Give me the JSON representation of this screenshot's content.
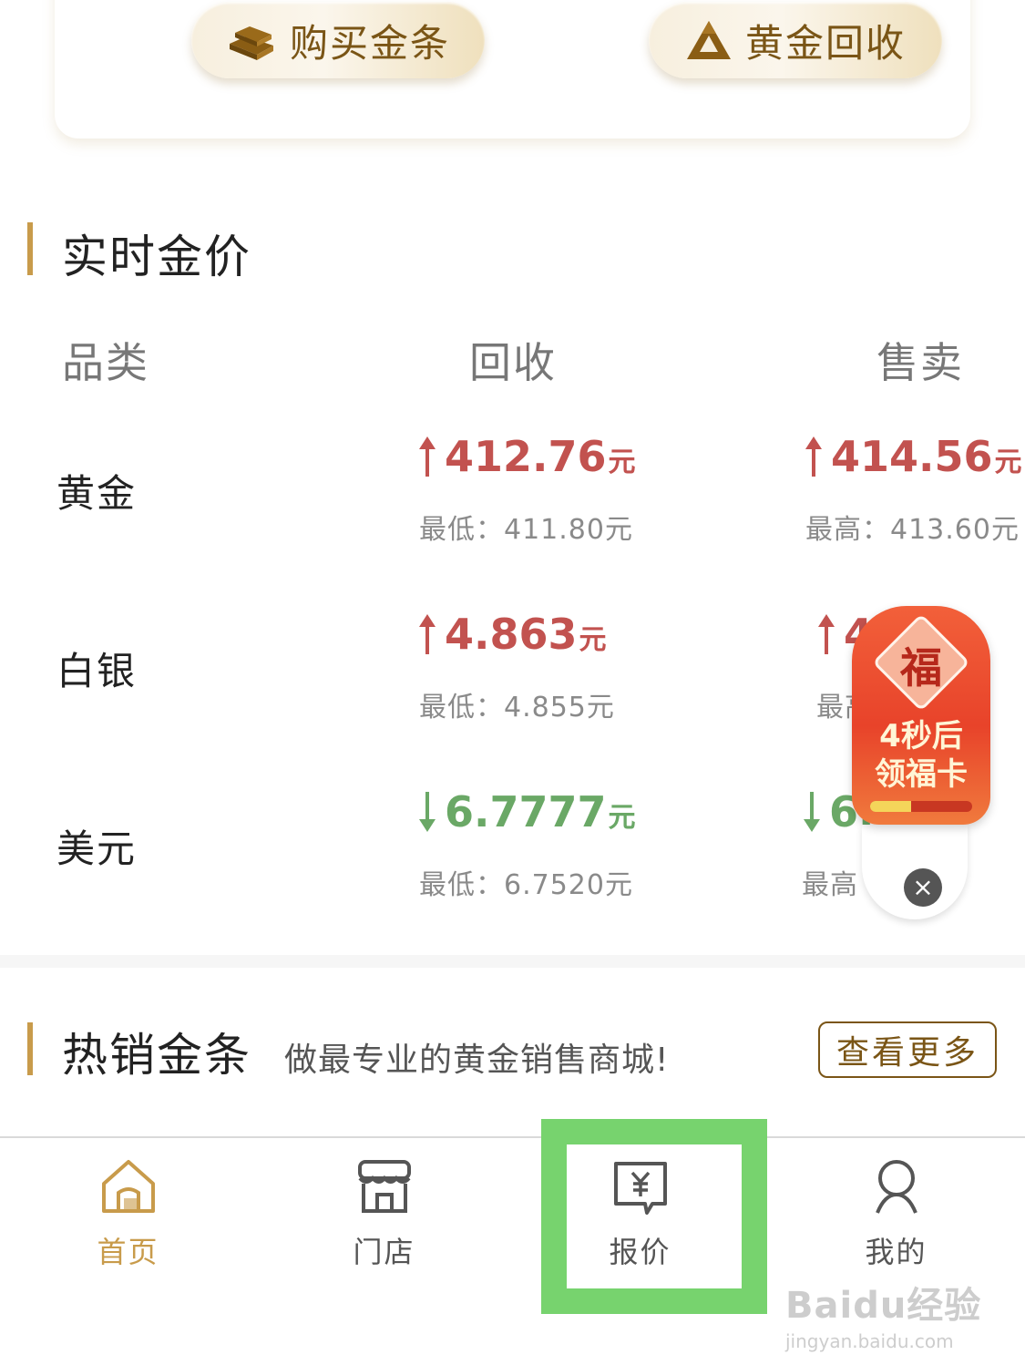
{
  "actions": {
    "buy_label": "购买金条",
    "recycle_label": "黄金回收"
  },
  "realtime": {
    "title": "实时金价",
    "headers": [
      "品类",
      "回收",
      "售卖"
    ],
    "rows": [
      {
        "name": "黄金",
        "recycle": "412.76",
        "recycle_dir": "up",
        "recycle_sub": "最低：411.80元",
        "sell": "414.56",
        "sell_dir": "up",
        "sell_sub": "最高：413.60元"
      },
      {
        "name": "白银",
        "recycle": "4.863",
        "recycle_dir": "up",
        "recycle_sub": "最低：4.855元",
        "sell": "4.",
        "sell_dir": "up",
        "sell_sub": "最高"
      },
      {
        "name": "美元",
        "recycle": "6.7777",
        "recycle_dir": "down",
        "recycle_sub": "最低：6.7520元",
        "sell": "6.",
        "sell_dir": "down",
        "sell_sub": "最高"
      }
    ],
    "unit": "元"
  },
  "hot": {
    "title": "热销金条",
    "subtitle": "做最专业的黄金销售商城!",
    "more_label": "查看更多"
  },
  "promo": {
    "fu_char": "福",
    "line1": "4秒后",
    "line2": "领福卡",
    "progress": 0.4,
    "close_label": "×"
  },
  "tabs": [
    {
      "label": "首页",
      "icon": "home-icon",
      "active": true
    },
    {
      "label": "门店",
      "icon": "store-icon",
      "active": false
    },
    {
      "label": "报价",
      "icon": "quote-icon",
      "active": false
    },
    {
      "label": "我的",
      "icon": "user-icon",
      "active": false
    }
  ],
  "watermark": {
    "line1": "Baidu经验",
    "line2": "jingyan.baidu.com"
  },
  "colors": {
    "gold": "#c89b4b",
    "up": "#c2524f",
    "down": "#6aa866",
    "highlight": "#77d36e"
  }
}
